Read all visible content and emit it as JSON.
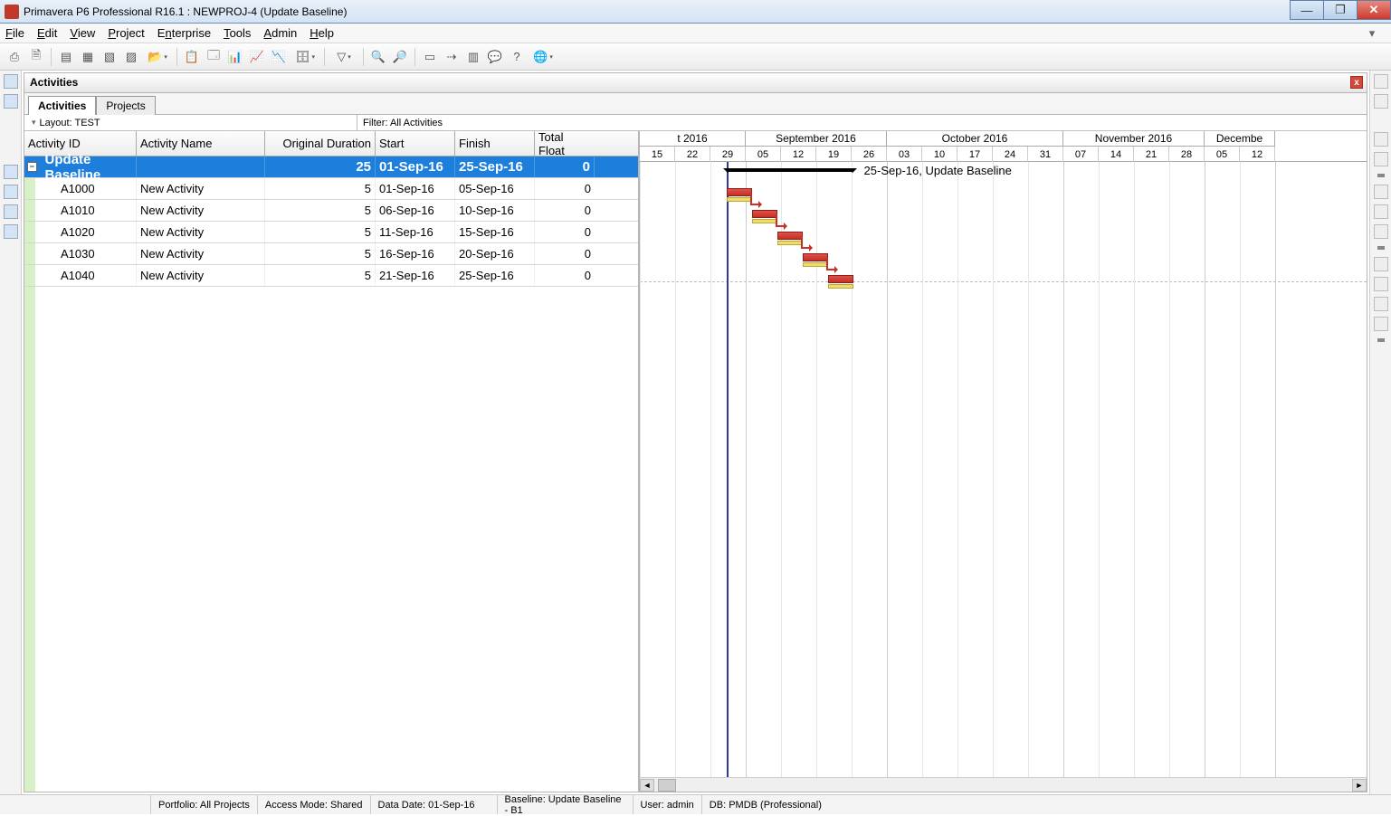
{
  "window": {
    "title": "Primavera P6 Professional R16.1 : NEWPROJ-4 (Update Baseline)"
  },
  "menu": {
    "file": "File",
    "edit": "Edit",
    "view": "View",
    "project": "Project",
    "enterprise": "Enterprise",
    "tools": "Tools",
    "admin": "Admin",
    "help": "Help"
  },
  "panel": {
    "title": "Activities"
  },
  "tabs": {
    "activities": "Activities",
    "projects": "Projects"
  },
  "layout": {
    "label": "Layout: TEST",
    "filter": "Filter: All Activities"
  },
  "columns": {
    "id": "Activity ID",
    "name": "Activity Name",
    "dur": "Original Duration",
    "start": "Start",
    "finish": "Finish",
    "tf": "Total Float"
  },
  "summary": {
    "name": "Update Baseline",
    "dur": "25",
    "start": "01-Sep-16",
    "finish": "25-Sep-16",
    "tf": "0",
    "gantt_label": "25-Sep-16, Update Baseline"
  },
  "rows": [
    {
      "id": "A1000",
      "name": "New Activity",
      "dur": "5",
      "start": "01-Sep-16",
      "finish": "05-Sep-16",
      "tf": "0"
    },
    {
      "id": "A1010",
      "name": "New Activity",
      "dur": "5",
      "start": "06-Sep-16",
      "finish": "10-Sep-16",
      "tf": "0"
    },
    {
      "id": "A1020",
      "name": "New Activity",
      "dur": "5",
      "start": "11-Sep-16",
      "finish": "15-Sep-16",
      "tf": "0"
    },
    {
      "id": "A1030",
      "name": "New Activity",
      "dur": "5",
      "start": "16-Sep-16",
      "finish": "20-Sep-16",
      "tf": "0"
    },
    {
      "id": "A1040",
      "name": "New Activity",
      "dur": "5",
      "start": "21-Sep-16",
      "finish": "25-Sep-16",
      "tf": "0"
    }
  ],
  "timeline": {
    "partial": "t 2016",
    "months": [
      "September 2016",
      "October 2016",
      "November 2016",
      "Decembe"
    ],
    "days": [
      "15",
      "22",
      "29",
      "05",
      "12",
      "19",
      "26",
      "03",
      "10",
      "17",
      "24",
      "31",
      "07",
      "14",
      "21",
      "28",
      "05",
      "12"
    ]
  },
  "status": {
    "portfolio": "Portfolio: All Projects",
    "access": "Access Mode: Shared",
    "datadate": "Data Date: 01-Sep-16",
    "baseline": "Baseline: Update Baseline - B1",
    "user": "User: admin",
    "db": "DB: PMDB (Professional)"
  },
  "chart_data": {
    "type": "gantt-table",
    "columns": [
      "Activity ID",
      "Activity Name",
      "Original Duration",
      "Start",
      "Finish",
      "Total Float"
    ],
    "summary": {
      "id": "",
      "name": "Update Baseline",
      "duration": 25,
      "start": "01-Sep-16",
      "finish": "25-Sep-16",
      "total_float": 0
    },
    "activities": [
      {
        "id": "A1000",
        "name": "New Activity",
        "duration": 5,
        "start": "01-Sep-16",
        "finish": "05-Sep-16",
        "total_float": 0
      },
      {
        "id": "A1010",
        "name": "New Activity",
        "duration": 5,
        "start": "06-Sep-16",
        "finish": "10-Sep-16",
        "total_float": 0
      },
      {
        "id": "A1020",
        "name": "New Activity",
        "duration": 5,
        "start": "11-Sep-16",
        "finish": "15-Sep-16",
        "total_float": 0
      },
      {
        "id": "A1030",
        "name": "New Activity",
        "duration": 5,
        "start": "16-Sep-16",
        "finish": "20-Sep-16",
        "total_float": 0
      },
      {
        "id": "A1040",
        "name": "New Activity",
        "duration": 5,
        "start": "21-Sep-16",
        "finish": "25-Sep-16",
        "total_float": 0
      }
    ],
    "data_date": "01-Sep-16"
  }
}
